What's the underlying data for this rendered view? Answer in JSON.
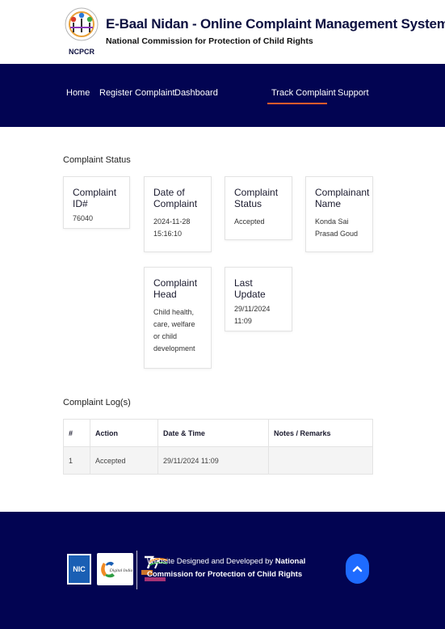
{
  "header": {
    "title": "E-Baal Nidan - Online Complaint Management System",
    "subtitle": "National Commission for Protection of Child Rights",
    "logo_caption": "NCPCR"
  },
  "nav": {
    "items": [
      {
        "label": "Home",
        "active": false
      },
      {
        "label": "Register Complaint",
        "active": false
      },
      {
        "label": "Dashboard",
        "active": false
      },
      {
        "label": "Track Complaint",
        "active": true
      },
      {
        "label": "Support",
        "active": false
      }
    ]
  },
  "status": {
    "section_title": "Complaint Status",
    "cards": [
      {
        "title": "Complaint ID#",
        "value": "76040"
      },
      {
        "title": "Date of Complaint",
        "value": "2024-11-28 15:16:10"
      },
      {
        "title": "Complaint Status",
        "value": "Accepted"
      },
      {
        "title": "Complainant Name",
        "value": "Konda Sai Prasad Goud"
      },
      {
        "title": "Complaint Head",
        "value": "Child health, care, welfare or child development"
      },
      {
        "title": "Last Update",
        "value": "29/11/2024 11:09"
      }
    ]
  },
  "log": {
    "section_title": "Complaint Log(s)",
    "columns": [
      "#",
      "Action",
      "Date & Time",
      "Notes / Remarks"
    ],
    "rows": [
      [
        "1",
        "Accepted",
        "29/11/2024 11:09",
        ""
      ]
    ]
  },
  "footer": {
    "text_prefix": "Website Designed and Developed by ",
    "text_org": "National Commission for Protection of Child Rights",
    "nic_label": "NIC",
    "digital_india_label": "Digital India"
  },
  "colors": {
    "navbar": "#020452",
    "accent": "#f25c2b",
    "scroll_button": "#1e6bff"
  }
}
